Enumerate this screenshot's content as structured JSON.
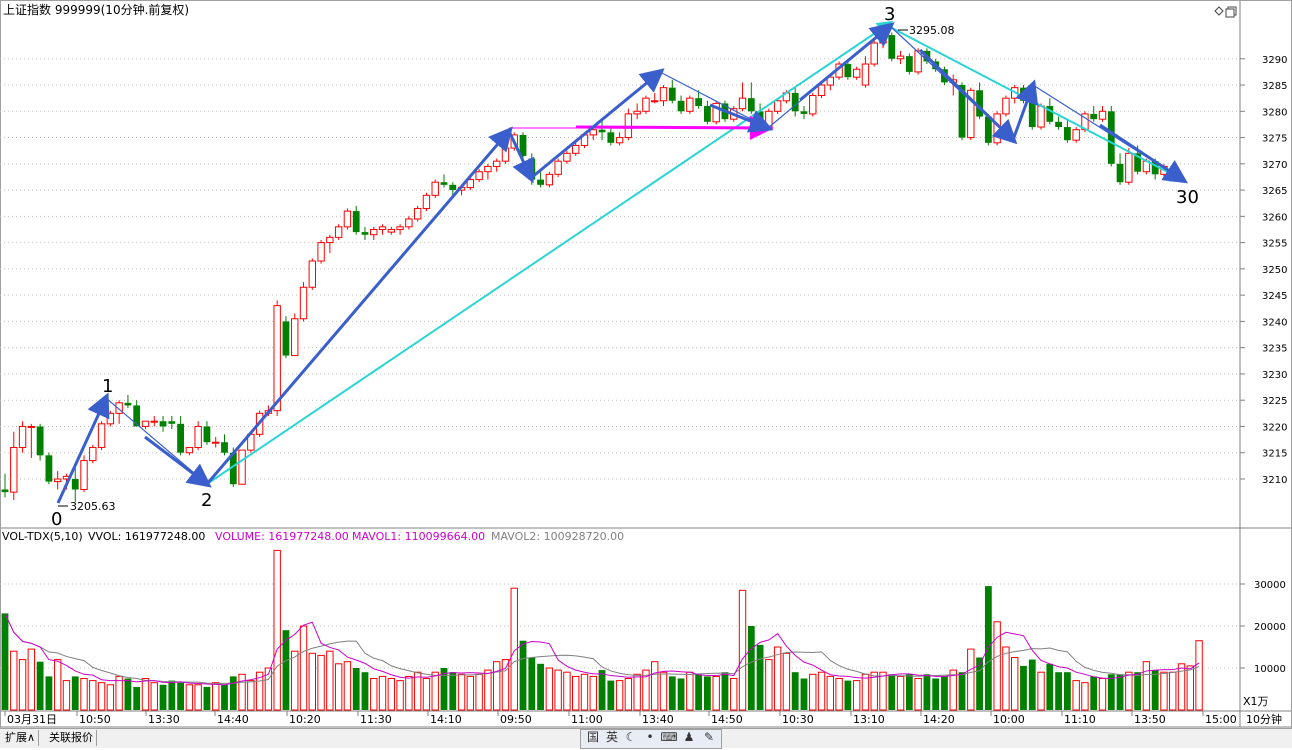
{
  "header": {
    "title": "上证指数 999999(10分钟.前复权)"
  },
  "price_scale": {
    "ticks": [
      "3290",
      "3285",
      "3280",
      "3275",
      "3270",
      "3265",
      "3260",
      "3255",
      "3250",
      "3245",
      "3240",
      "3235",
      "3230",
      "3225",
      "3220",
      "3215",
      "3210"
    ]
  },
  "annotations": {
    "wave_labels": [
      "0",
      "1",
      "2",
      "3",
      "30"
    ],
    "low_price_label": "3205.63",
    "high_price_label": "3295.08"
  },
  "volume_panel": {
    "legend_indicator": "VOL-TDX(5,10)",
    "legend_vvol": "VVOL: 161977248.00",
    "legend_volume": "VOLUME: 161977248.00",
    "legend_mavol1": "MAVOL1: 110099664.00",
    "legend_mavol2": "MAVOL2: 100928720.00",
    "scale_ticks": [
      "30000",
      "20000",
      "10000"
    ],
    "unit_label": "X1万"
  },
  "time_axis": {
    "labels": [
      "03月31日",
      "10:50",
      "13:30",
      "14:40",
      "10:20",
      "11:30",
      "14:10",
      "09:50",
      "11:00",
      "13:40",
      "14:50",
      "10:30",
      "13:10",
      "14:20",
      "10:00",
      "11:10",
      "13:50",
      "15:00"
    ],
    "period_label": "10分钟"
  },
  "bottom_bar": {
    "tabs": [
      "扩展∧",
      "关联报价"
    ],
    "tray_labels": [
      "国",
      "英"
    ]
  },
  "colors": {
    "up": "#ff0000",
    "down": "#008000",
    "wave_arrow": "#3a5fcd",
    "trend_line": "#2ad4d4",
    "magenta_line": "#ff00ff",
    "mavol1": "#cc00cc",
    "mavol2": "#808080",
    "grid": "#c0c0c0"
  },
  "chart_data": [
    {
      "type": "candlestick",
      "title": "上证指数 999999(10分钟.前复权)",
      "ylim": [
        3202,
        3297
      ],
      "x": [
        "03月31日",
        "10:50",
        "13:30",
        "14:40",
        "10:20",
        "11:30",
        "14:10",
        "09:50",
        "11:00",
        "13:40",
        "14:50",
        "10:30",
        "13:10",
        "14:20",
        "10:00",
        "11:10",
        "13:50",
        "15:00"
      ],
      "ohlc": [
        [
          3208,
          3211,
          3206.5,
          3207.5
        ],
        [
          3207.5,
          3219,
          3206,
          3216
        ],
        [
          3216,
          3221,
          3215,
          3220
        ],
        [
          3220,
          3220.5,
          3214,
          3220
        ],
        [
          3220,
          3220.5,
          3213.5,
          3214.5
        ],
        [
          3214.5,
          3215,
          3209,
          3209.5
        ],
        [
          3209.5,
          3211.5,
          3208,
          3210
        ],
        [
          3210,
          3211,
          3208,
          3210.5
        ],
        [
          3210,
          3213,
          3205.6,
          3208
        ],
        [
          3208,
          3214.5,
          3207.5,
          3213.5
        ],
        [
          3213.5,
          3216.5,
          3213,
          3216
        ],
        [
          3216,
          3221,
          3215.5,
          3220.5
        ],
        [
          3220.5,
          3223,
          3220,
          3222.5
        ],
        [
          3222.5,
          3225,
          3220.5,
          3224.5
        ],
        [
          3224.5,
          3226,
          3223.5,
          3224
        ],
        [
          3224,
          3225,
          3220,
          3220
        ],
        [
          3220,
          3221,
          3219.5,
          3221
        ],
        [
          3221,
          3222,
          3220,
          3221
        ],
        [
          3221,
          3222,
          3219,
          3220
        ],
        [
          3221,
          3222,
          3219.5,
          3220.5
        ],
        [
          3220.5,
          3222,
          3214.5,
          3215
        ],
        [
          3215,
          3216,
          3214.5,
          3216
        ],
        [
          3216,
          3221,
          3215.5,
          3220
        ],
        [
          3220,
          3221,
          3216.5,
          3217
        ],
        [
          3217,
          3218,
          3216,
          3217
        ],
        [
          3217,
          3218.5,
          3214.5,
          3215
        ],
        [
          3215,
          3216,
          3208.5,
          3209
        ],
        [
          3209,
          3215.5,
          3209,
          3215.5
        ],
        [
          3215.5,
          3219,
          3215,
          3218.5
        ],
        [
          3218.5,
          3223,
          3218,
          3222.5
        ],
        [
          3222.5,
          3224,
          3222,
          3223
        ],
        [
          3223,
          3244,
          3222,
          3243
        ],
        [
          3240,
          3241,
          3233,
          3233.5
        ],
        [
          3233.5,
          3241.5,
          3233.5,
          3240.5
        ],
        [
          3240.5,
          3247.5,
          3240,
          3246.5
        ],
        [
          3246.5,
          3252,
          3246,
          3251.5
        ],
        [
          3251.5,
          3255.5,
          3251,
          3255
        ],
        [
          3255,
          3256.5,
          3253,
          3256
        ],
        [
          3256,
          3258.5,
          3255.5,
          3258
        ],
        [
          3258,
          3261.5,
          3257.5,
          3261
        ],
        [
          3261,
          3262,
          3256.5,
          3257
        ],
        [
          3257,
          3258,
          3255.5,
          3256.5
        ],
        [
          3256.5,
          3258,
          3255.5,
          3257.5
        ],
        [
          3257.5,
          3258.5,
          3256.5,
          3258
        ],
        [
          3257,
          3258,
          3256.5,
          3257.5
        ],
        [
          3257.5,
          3258.5,
          3256.5,
          3258
        ],
        [
          3258,
          3260,
          3257.5,
          3259.5
        ],
        [
          3259.5,
          3262,
          3259,
          3261.5
        ],
        [
          3261.5,
          3264.5,
          3261,
          3264
        ],
        [
          3264,
          3267,
          3263.5,
          3266.5
        ],
        [
          3266.5,
          3268,
          3265.5,
          3266
        ],
        [
          3266,
          3266.5,
          3264,
          3265
        ],
        [
          3265,
          3266,
          3264,
          3265.5
        ],
        [
          3265.5,
          3267.5,
          3265,
          3267
        ],
        [
          3267,
          3269,
          3266.5,
          3268.5
        ],
        [
          3268.5,
          3270,
          3267,
          3269.5
        ],
        [
          3269.5,
          3271,
          3268.5,
          3270.5
        ],
        [
          3270.5,
          3273.5,
          3270,
          3273
        ],
        [
          3273,
          3276,
          3272.5,
          3275.5
        ],
        [
          3275.5,
          3276,
          3271,
          3271.5
        ],
        [
          3271,
          3272,
          3266,
          3267
        ],
        [
          3267,
          3268.5,
          3265.5,
          3266
        ],
        [
          3266,
          3268.5,
          3265.5,
          3268
        ],
        [
          3268,
          3271,
          3267.5,
          3270.5
        ],
        [
          3270.5,
          3272.5,
          3270,
          3272
        ],
        [
          3272,
          3274,
          3271.5,
          3273.5
        ],
        [
          3273.5,
          3276,
          3273,
          3275.5
        ],
        [
          3275.5,
          3277,
          3274.5,
          3276.5
        ],
        [
          3276.5,
          3278.5,
          3274.5,
          3276
        ],
        [
          3276,
          3277,
          3273.5,
          3274
        ],
        [
          3274,
          3276,
          3273.5,
          3275
        ],
        [
          3275,
          3280.5,
          3274.5,
          3279.5
        ],
        [
          3279.5,
          3281.5,
          3278.5,
          3280
        ],
        [
          3280,
          3283,
          3279.5,
          3282.5
        ],
        [
          3282,
          3283.5,
          3281.5,
          3282
        ],
        [
          3282,
          3285,
          3281,
          3284.5
        ],
        [
          3284.5,
          3286,
          3281.5,
          3282
        ],
        [
          3282,
          3283,
          3279.5,
          3280
        ],
        [
          3280,
          3283,
          3279.5,
          3282.5
        ],
        [
          3282.5,
          3284,
          3280.5,
          3281
        ],
        [
          3281,
          3282,
          3277.5,
          3278
        ],
        [
          3278,
          3282,
          3277.5,
          3281.5
        ],
        [
          3281.5,
          3282,
          3278,
          3278.5
        ],
        [
          3278.5,
          3281,
          3278,
          3280.5
        ],
        [
          3280.5,
          3285.5,
          3280,
          3282.5
        ],
        [
          3282.5,
          3285.5,
          3279.5,
          3280
        ],
        [
          3280,
          3281.5,
          3276.5,
          3277
        ],
        [
          3277,
          3280.5,
          3276.5,
          3280
        ],
        [
          3280,
          3282.5,
          3279.5,
          3282
        ],
        [
          3282,
          3284,
          3281.5,
          3283.5
        ],
        [
          3283.5,
          3284.5,
          3279,
          3280
        ],
        [
          3280,
          3281,
          3278.5,
          3279.5
        ],
        [
          3279.5,
          3283.5,
          3279,
          3283
        ],
        [
          3283,
          3285.5,
          3282.5,
          3285
        ],
        [
          3285,
          3287,
          3284,
          3286.5
        ],
        [
          3286.5,
          3289.5,
          3286,
          3289
        ],
        [
          3289,
          3290,
          3286,
          3286.5
        ],
        [
          3286.5,
          3288.5,
          3286,
          3288
        ],
        [
          3285,
          3290.5,
          3284.5,
          3289
        ],
        [
          3289,
          3293.5,
          3288.5,
          3293
        ],
        [
          3293,
          3295.1,
          3292,
          3294.5
        ],
        [
          3294.5,
          3295,
          3289.5,
          3290
        ],
        [
          3290,
          3291.5,
          3289,
          3290.5
        ],
        [
          3290.5,
          3291,
          3287,
          3287.5
        ],
        [
          3287.5,
          3292,
          3287,
          3291.5
        ],
        [
          3291.5,
          3292,
          3289,
          3289.5
        ],
        [
          3289.5,
          3290,
          3287.5,
          3288
        ],
        [
          3288,
          3288.5,
          3285,
          3285.5
        ],
        [
          3285.5,
          3287,
          3283,
          3286
        ],
        [
          3285,
          3285.5,
          3274.5,
          3275
        ],
        [
          3275,
          3284.5,
          3274.5,
          3284
        ],
        [
          3284,
          3285.5,
          3278.5,
          3279
        ],
        [
          3279,
          3279.5,
          3273.5,
          3274
        ],
        [
          3274,
          3280,
          3273.5,
          3279.5
        ],
        [
          3279.5,
          3283,
          3279,
          3282.5
        ],
        [
          3282.5,
          3285,
          3281.5,
          3284.5
        ],
        [
          3284.5,
          3285,
          3281.5,
          3282
        ],
        [
          3282,
          3283,
          3276.5,
          3277
        ],
        [
          3277,
          3281.5,
          3276.5,
          3281
        ],
        [
          3281,
          3282.5,
          3277.5,
          3278
        ],
        [
          3278,
          3279,
          3276.5,
          3277
        ],
        [
          3277,
          3278.5,
          3274,
          3274.5
        ],
        [
          3274.5,
          3277,
          3274,
          3276.5
        ],
        [
          3276.5,
          3280,
          3276,
          3279.5
        ],
        [
          3279.5,
          3281,
          3278,
          3278.5
        ],
        [
          3278.5,
          3281,
          3278,
          3280
        ],
        [
          3280,
          3281,
          3269.5,
          3270
        ],
        [
          3270,
          3272,
          3266,
          3266.5
        ],
        [
          3266.5,
          3273,
          3266,
          3272
        ],
        [
          3272,
          3273.5,
          3268,
          3268.5
        ],
        [
          3268.5,
          3271,
          3268,
          3270.5
        ],
        [
          3270.5,
          3271,
          3267,
          3268
        ],
        [
          3268,
          3270,
          3267.5,
          3269.5
        ]
      ]
    },
    {
      "type": "bar",
      "title": "VOL-TDX(5,10)",
      "ylim": [
        0,
        40000
      ],
      "values": [
        23000,
        14000,
        12000,
        14500,
        11500,
        8000,
        12000,
        7000,
        8000,
        7500,
        7000,
        6500,
        6000,
        8000,
        7500,
        5500,
        7500,
        6500,
        6000,
        7000,
        6500,
        6000,
        6000,
        5500,
        6500,
        6000,
        8000,
        8500,
        7000,
        9000,
        10000,
        38000,
        19000,
        14000,
        20000,
        13500,
        13000,
        14000,
        11000,
        11500,
        10000,
        9000,
        7500,
        8000,
        7500,
        7000,
        8000,
        9000,
        7500,
        9000,
        10000,
        9000,
        8500,
        8000,
        8500,
        9500,
        11500,
        12000,
        29000,
        16500,
        12500,
        11000,
        10000,
        9500,
        9000,
        8000,
        8500,
        8000,
        9500,
        7000,
        7000,
        7500,
        8500,
        9500,
        11500,
        9000,
        8000,
        7500,
        9000,
        8500,
        8000,
        8000,
        9000,
        7500,
        28500,
        20000,
        15500,
        12000,
        15000,
        13500,
        9000,
        7500,
        8500,
        9000,
        8000,
        7500,
        7000,
        7000,
        8500,
        9000,
        9000,
        8500,
        8000,
        8500,
        7500,
        8500,
        7500,
        8000,
        9500,
        9000,
        14500,
        12500,
        29500,
        21000,
        15000,
        12500,
        10500,
        12000,
        9000,
        11000,
        9000,
        9000,
        7000,
        6500,
        8000,
        7500,
        8500,
        8500,
        9000,
        9000,
        11500,
        9500,
        9000,
        9000,
        11000,
        10500,
        16500
      ],
      "series": [
        {
          "name": "MAVOL1",
          "last": 110099664.0
        },
        {
          "name": "MAVOL2",
          "last": 100928720.0
        }
      ]
    }
  ]
}
